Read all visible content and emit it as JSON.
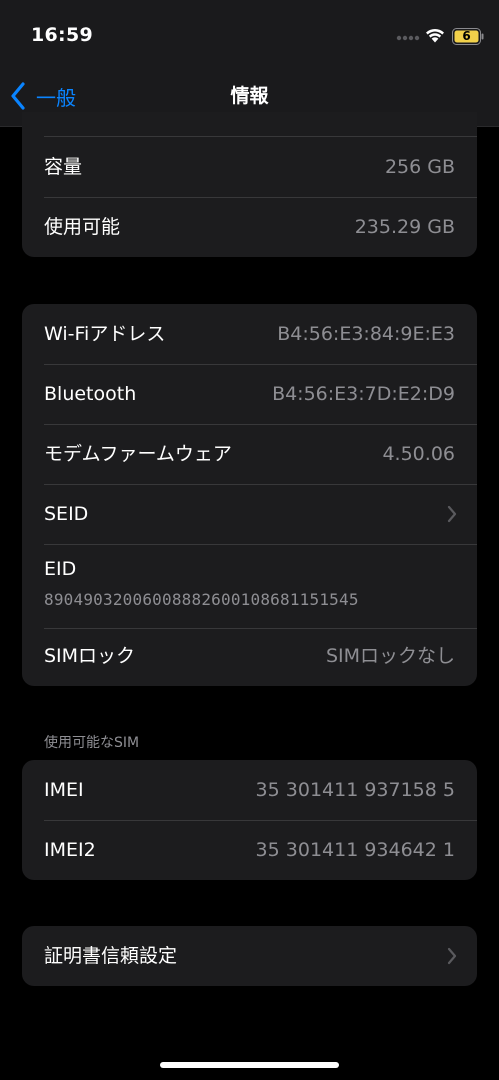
{
  "status_bar": {
    "time": "16:59",
    "battery_level": "6"
  },
  "nav": {
    "back_label": "一般",
    "title": "情報"
  },
  "storage_group": {
    "rows": [
      {
        "label": "容量",
        "value": "256 GB"
      },
      {
        "label": "使用可能",
        "value": "235.29 GB"
      }
    ]
  },
  "network_group": {
    "rows": [
      {
        "label": "Wi-Fiアドレス",
        "value": "B4:56:E3:84:9E:E3"
      },
      {
        "label": "Bluetooth",
        "value": "B4:56:E3:7D:E2:D9"
      },
      {
        "label": "モデムファームウェア",
        "value": "4.50.06"
      },
      {
        "label": "SEID",
        "value": ""
      }
    ],
    "eid": {
      "label": "EID",
      "value": "89049032006008882600108681151545"
    },
    "sim_lock": {
      "label": "SIMロック",
      "value": "SIMロックなし"
    }
  },
  "sim_section": {
    "header": "使用可能なSIM",
    "rows": [
      {
        "label": "IMEI",
        "value": "35 301411 937158 5"
      },
      {
        "label": "IMEI2",
        "value": "35 301411 934642 1"
      }
    ]
  },
  "cert_group": {
    "label": "証明書信頼設定"
  },
  "colors": {
    "accent": "#0a84ff",
    "background": "#000000",
    "cell_background": "#1c1c1e",
    "secondary_text": "#8e8e93",
    "separator": "#38383a"
  },
  "icons": {
    "back": "chevron-left-icon",
    "disclosure": "chevron-right-icon",
    "wifi": "wifi-icon",
    "battery": "battery-icon",
    "signal": "signal-dots-icon"
  }
}
